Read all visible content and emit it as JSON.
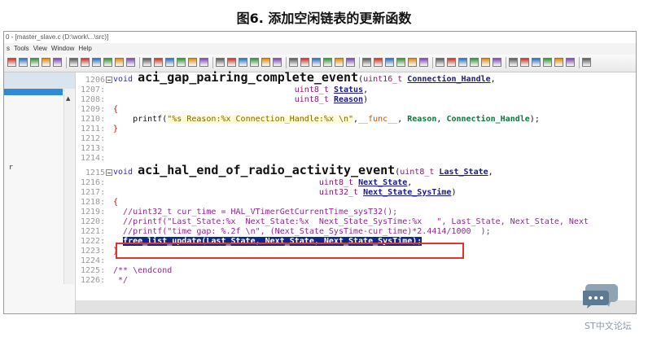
{
  "caption": "图6. 添加空闲链表的更新函数",
  "window": {
    "title": "0 - [master_slave.c (D:\\work\\...\\src)]",
    "menu": [
      "s",
      "Tools",
      "View",
      "Window",
      "Help"
    ]
  },
  "sidebar": {
    "marker": "r"
  },
  "editor": {
    "lines": [
      {
        "n": "1206",
        "fold": true,
        "html": "<span class=\"kw\">void</span> <span class=\"fn\">aci_gap_pairing_complete_event</span>(<span class=\"ty\">uint16_t</span> <span class=\"pm\">Connection_Handle</span>,"
      },
      {
        "n": "1207:",
        "fold": false,
        "html": "                                     <span class=\"ty\">uint8_t</span> <span class=\"pm\">Status</span>,"
      },
      {
        "n": "1208:",
        "fold": false,
        "html": "                                     <span class=\"ty\">uint8_t</span> <span class=\"pm\">Reason</span>)"
      },
      {
        "n": "1209:",
        "fold": false,
        "html": "<span class=\"br\">{</span>"
      },
      {
        "n": "1210:",
        "fold": false,
        "html": "    printf(<span class=\"st\">\"%s Reason:%x Connection_Handle:%x \\n\"</span>,<span class=\"mac\">__func__</span>, <span class=\"var\">Reason</span>, <span class=\"var\">Connection_Handle</span>);"
      },
      {
        "n": "1211:",
        "fold": false,
        "html": "<span class=\"br\">}</span>"
      },
      {
        "n": "1212:",
        "fold": false,
        "html": ""
      },
      {
        "n": "1213:",
        "fold": false,
        "html": ""
      },
      {
        "n": "1214:",
        "fold": false,
        "html": ""
      },
      {
        "n": "1215",
        "fold": true,
        "html": "<span class=\"kw\">void</span> <span class=\"fn\">aci_hal_end_of_radio_activity_event</span>(<span class=\"ty\">uint8_t</span> <span class=\"pm\">Last_State</span>,"
      },
      {
        "n": "1216:",
        "fold": false,
        "html": "                                          <span class=\"ty\">uint8_t</span> <span class=\"pm\">Next_State</span>,"
      },
      {
        "n": "1217:",
        "fold": false,
        "html": "                                          <span class=\"ty\">uint32_t</span> <span class=\"pm\">Next_State_SysTime</span>)"
      },
      {
        "n": "1218:",
        "fold": false,
        "html": "<span class=\"br\">{</span>"
      },
      {
        "n": "1219:",
        "fold": false,
        "html": "  <span class=\"cm\">//uint32_t cur_time = HAL_VTimerGetCurrentTime_sysT32();</span>"
      },
      {
        "n": "1220:",
        "fold": false,
        "html": "  <span class=\"cm\">//printf(\"Last_State:%x  Next_State:%x  Next_State_SysTime:%x   \", Last_State, Next_State, Next</span>"
      },
      {
        "n": "1221:",
        "fold": false,
        "html": "  <span class=\"cm\">//printf(\"time gap: %.2f \\n\", (Next_State_SysTime-cur_time)*2.4414/1000  );</span>"
      },
      {
        "n": "1222:",
        "fold": false,
        "html": "  <span class=\"sel\">free_list_update(Last_State, Next_State, Next_State_SysTime);</span>"
      },
      {
        "n": "1223:",
        "fold": false,
        "html": "<span class=\"br\">}</span>"
      },
      {
        "n": "1224:",
        "fold": false,
        "html": ""
      },
      {
        "n": "1225:",
        "fold": false,
        "html": "<span class=\"cm\">/** \\endcond</span>"
      },
      {
        "n": "1226:",
        "fold": false,
        "html": "<span class=\"cm\"> */</span>"
      }
    ]
  },
  "watermark": {
    "text": "ST中文论坛"
  },
  "colors": {
    "highlight_box": "#e53030",
    "selection": "#0a2a8a",
    "keyword": "#2b2bd0"
  }
}
